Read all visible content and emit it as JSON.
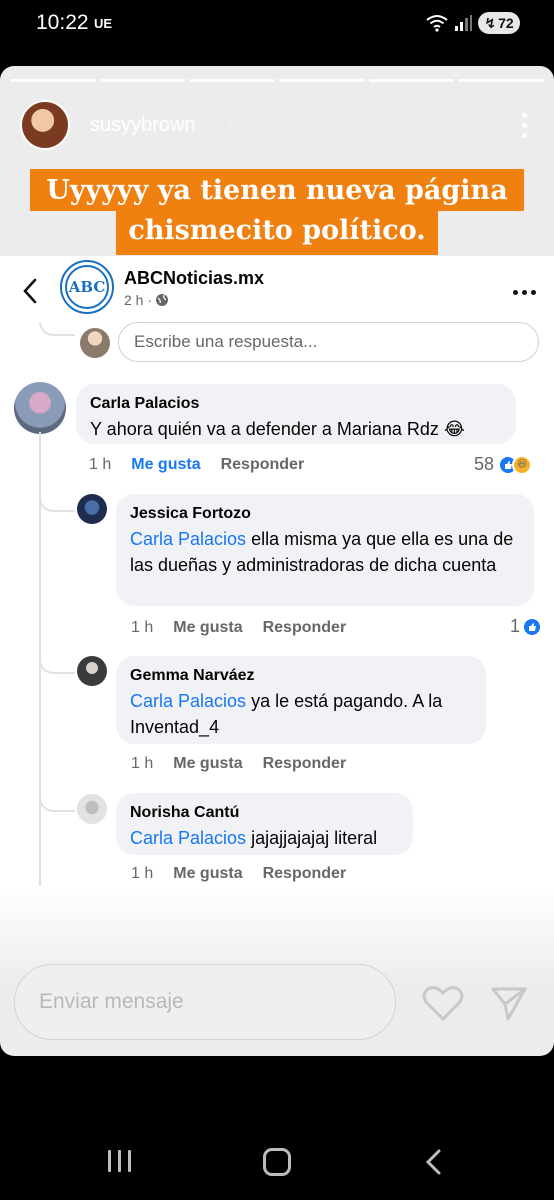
{
  "status_bar": {
    "time": "10:22",
    "carrier": "UE",
    "battery": "72"
  },
  "story": {
    "username": "susyybrown",
    "time_ago": "11 h",
    "banner_line1": "Uyyyyy ya tienen nueva página",
    "banner_line2": "chismecito político."
  },
  "page_post": {
    "page_name": "ABCNoticias.mx",
    "logo_text": "ABC",
    "post_time": "2 h ·",
    "reply_placeholder": "Escribe una respuesta..."
  },
  "comments": [
    {
      "name": "Carla Palacios",
      "mention": "",
      "text": "Y ahora quién va a defender a Mariana Rdz 😂",
      "time": "1 h",
      "like": "Me gusta",
      "reply": "Responder",
      "reactions": "58"
    },
    {
      "name": "Jessica Fortozo",
      "mention": "Carla Palacios",
      "text": " ella misma ya que ella es una de las dueñas y administradoras de dicha cuenta",
      "time": "1 h",
      "like": "Me gusta",
      "reply": "Responder",
      "reactions": "1"
    },
    {
      "name": "Gemma Narváez",
      "mention": "Carla Palacios",
      "text": " ya le está pagando. A la Inventad_4",
      "time": "1 h",
      "like": "Me gusta",
      "reply": "Responder",
      "reactions": ""
    },
    {
      "name": "Norisha Cantú",
      "mention": "Carla Palacios",
      "text": " jajajjajajaj literal",
      "time": "1 h",
      "like": "Me gusta",
      "reply": "Responder",
      "reactions": ""
    }
  ],
  "message_bar": {
    "placeholder": "Enviar mensaje"
  },
  "icons": {
    "wifi": "wifi-icon",
    "signal": "signal-icon",
    "heart": "heart-icon",
    "send": "send-icon",
    "back": "chevron-left-icon",
    "globe": "globe-icon",
    "like": "like-reaction-icon",
    "haha": "haha-reaction-icon"
  },
  "colors": {
    "banner": "#f08010",
    "mention": "#1877f2",
    "bubble": "#f0f2f5",
    "logo": "#1a6fc0"
  }
}
